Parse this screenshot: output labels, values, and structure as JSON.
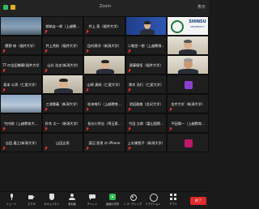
{
  "window": {
    "title": "Zoom",
    "view_label": "表示"
  },
  "participants": [
    {
      "name": "",
      "label": ""
    },
    {
      "name": "都筑友一郎（上越教...",
      "label": ""
    },
    {
      "name": "井上 直（福井大学）",
      "label": ""
    },
    {
      "name": "",
      "label": ""
    },
    {
      "name": "",
      "label": ""
    },
    {
      "name": "鷹野 修（福井大学）",
      "label": ""
    },
    {
      "name": "井上秀則（福井大学）",
      "label": ""
    },
    {
      "name": "田村建洋（新潟大学）",
      "label": ""
    },
    {
      "name": "二階堂一樹（上越教育...",
      "label": ""
    },
    {
      "name": "",
      "label": ""
    },
    {
      "name": "TT-の会田敬蔵(福井大学)",
      "label": ""
    },
    {
      "name": "山谷 浩史(新潟大学)",
      "label": ""
    },
    {
      "name": "",
      "label": ""
    },
    {
      "name": "遠藤慎悟（福井大学）",
      "label": ""
    },
    {
      "name": "",
      "label": ""
    },
    {
      "name": "坂本 公男（仁愛大学）",
      "label": ""
    },
    {
      "name": "",
      "label": ""
    },
    {
      "name": "山崎 真純（仁愛大学）",
      "label": ""
    },
    {
      "name": "黒木 浩行（仁愛大学）",
      "label": ""
    },
    {
      "name": "",
      "label": ""
    },
    {
      "name": "",
      "label": ""
    },
    {
      "name": "三浦貴義（新潟大学）",
      "label": ""
    },
    {
      "name": "松本唯行（上越教育...",
      "label": ""
    },
    {
      "name": "池田雅美（金沢大学）",
      "label": ""
    },
    {
      "name": "金井大学（新潟大学）",
      "label": ""
    },
    {
      "name": "竹内剛（上越教育大...",
      "label": ""
    },
    {
      "name": "鈴木 太一（新潟大学）",
      "label": ""
    },
    {
      "name": "長谷川秀志（埼玉県...",
      "label": ""
    },
    {
      "name": "竹田 太郎（富山国際...",
      "label": ""
    },
    {
      "name": "平田陽一（上越教育...",
      "label": ""
    },
    {
      "name": "吉田 嘉之(新潟大学)",
      "label": ""
    },
    {
      "name": "山田吉男",
      "label": ""
    },
    {
      "name": "渡辺 鉄男 の iPhone",
      "label": ""
    },
    {
      "name": "上杉美智子（新潟大学）",
      "label": ""
    },
    {
      "name": "",
      "label": ""
    }
  ],
  "toolbar": {
    "mic": "ミュート",
    "camera": "ビデオ",
    "security": "セキュリティ",
    "participants": "参加者",
    "chat": "チャット",
    "share": "画面の共有",
    "record": "レコーディング",
    "reactions": "リアクション",
    "apps": "アプリ",
    "more": "詳細",
    "end": "終了"
  },
  "colors": {
    "share_green": "#2fbf5a",
    "end_red": "#e0292b",
    "purple_avatar": "#8a3fd1",
    "magenta_avatar": "#c0176a"
  }
}
